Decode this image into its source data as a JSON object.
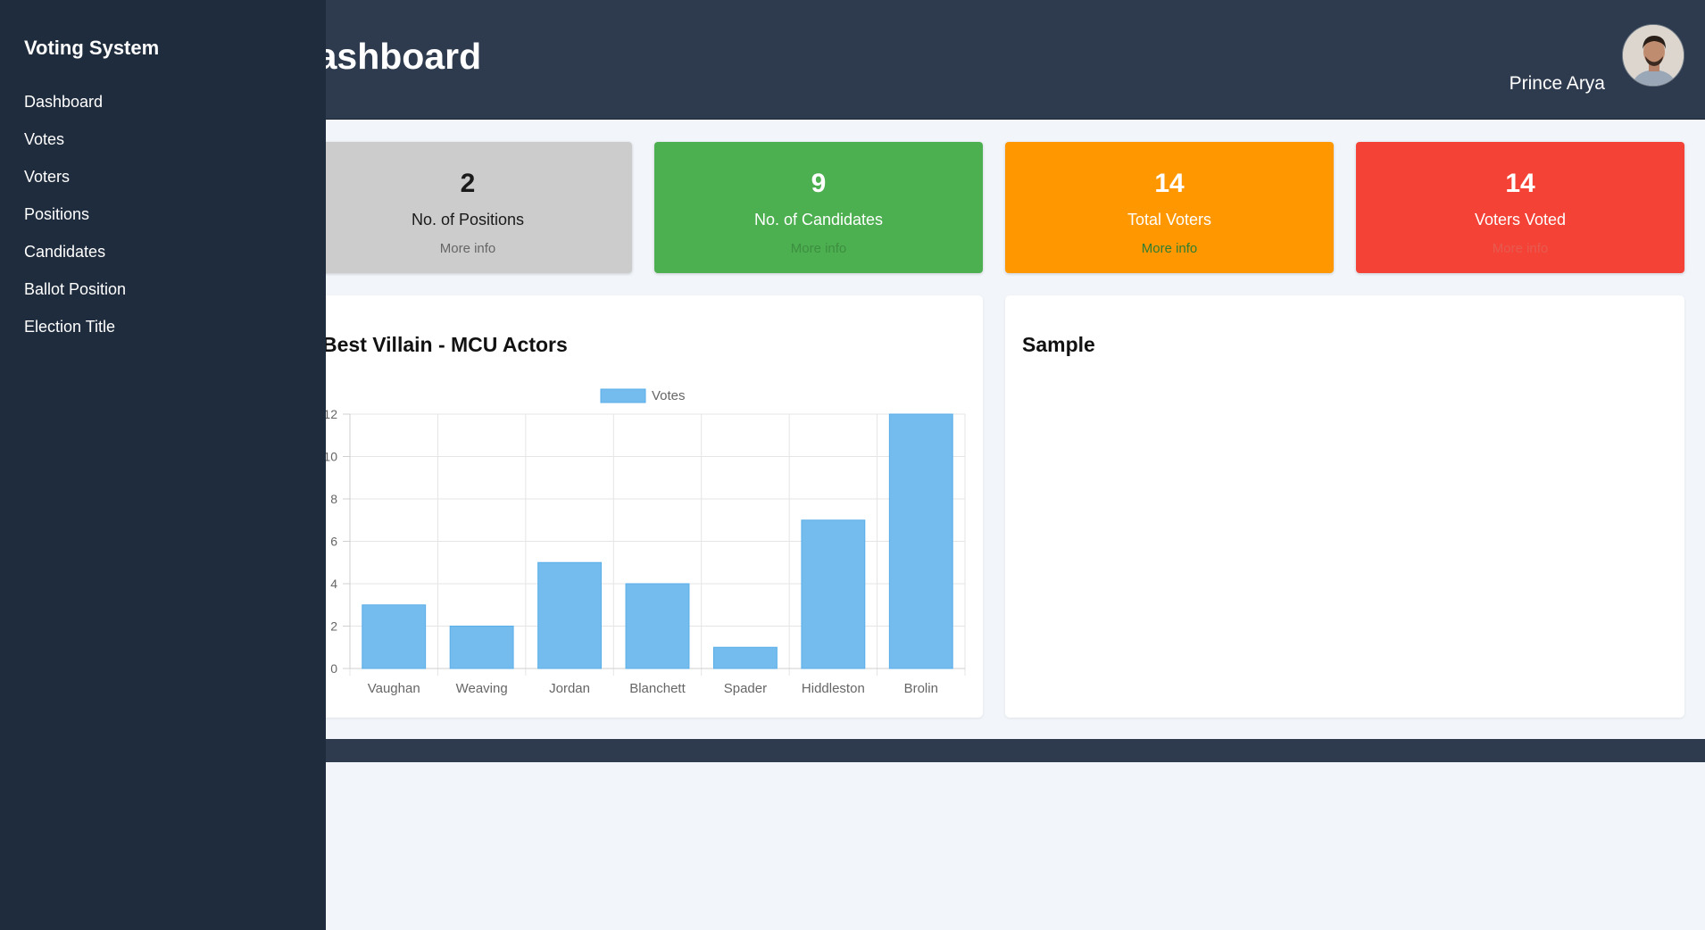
{
  "sidebar": {
    "brand": "Voting System",
    "items": [
      {
        "label": "Dashboard"
      },
      {
        "label": "Votes"
      },
      {
        "label": "Voters"
      },
      {
        "label": "Positions"
      },
      {
        "label": "Candidates"
      },
      {
        "label": "Ballot Position"
      },
      {
        "label": "Election Title"
      }
    ]
  },
  "header": {
    "title": "Dashboard",
    "user_name": "Prince Arya"
  },
  "cards": [
    {
      "count": "2",
      "label": "No. of Positions",
      "more": "More info",
      "bg": "#cccccc",
      "text_color": "#1a1a1a",
      "more_color": "#666666"
    },
    {
      "count": "9",
      "label": "No. of Candidates",
      "more": "More info",
      "bg": "#4caf50",
      "text_color": "#ffffff",
      "more_color": "#3d8f40"
    },
    {
      "count": "14",
      "label": "Total Voters",
      "more": "More info",
      "bg": "#ff9800",
      "text_color": "#ffffff",
      "more_color": "#2e7d32"
    },
    {
      "count": "14",
      "label": "Voters Voted",
      "more": "More info",
      "bg": "#f44336",
      "text_color": "#ffffff",
      "more_color": "#e65a50"
    }
  ],
  "panels": {
    "left_title": "Best Villain - MCU Actors",
    "right_title": "Sample"
  },
  "chart_data": {
    "type": "bar",
    "categories": [
      "Vaughan",
      "Weaving",
      "Jordan",
      "Blanchett",
      "Spader",
      "Hiddleston",
      "Brolin"
    ],
    "series": [
      {
        "name": "Votes",
        "values": [
          3,
          2,
          5,
          4,
          1,
          7,
          12
        ]
      }
    ],
    "ylim": [
      0,
      12
    ],
    "yticks": [
      0,
      2,
      4,
      6,
      8,
      10,
      12
    ],
    "grid": true,
    "legend": "top",
    "bar_color": "#74bcee",
    "bar_border": "#5aaee8"
  }
}
